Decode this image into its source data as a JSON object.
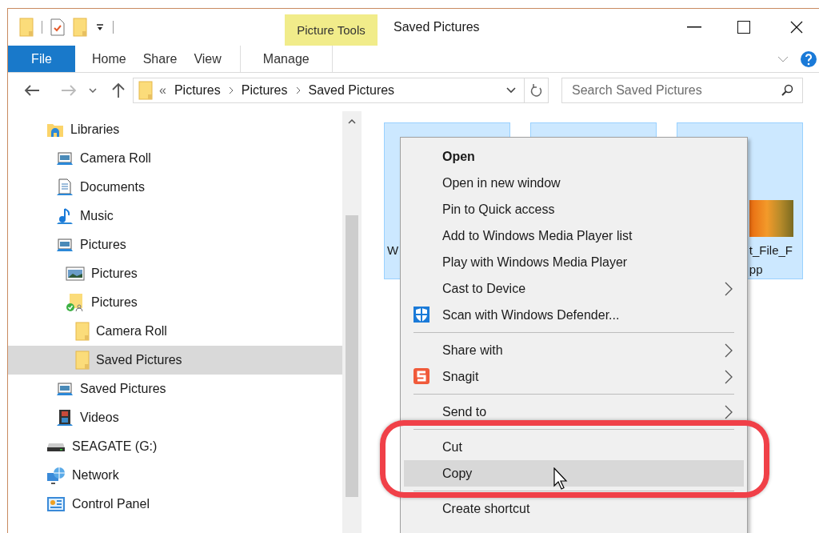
{
  "window": {
    "title": "Saved Pictures"
  },
  "ribbon": {
    "contextual_group": "Picture Tools",
    "tabs": [
      {
        "label": "File",
        "kind": "file"
      },
      {
        "label": "Home",
        "kind": "normal"
      },
      {
        "label": "Share",
        "kind": "normal"
      },
      {
        "label": "View",
        "kind": "normal"
      },
      {
        "label": "Manage",
        "kind": "contextual"
      }
    ]
  },
  "address_bar": {
    "overflow_mark": "«",
    "crumbs": [
      "Pictures",
      "Pictures",
      "Saved Pictures"
    ]
  },
  "search": {
    "placeholder": "Search Saved Pictures"
  },
  "sidebar": {
    "items": [
      {
        "label": "Libraries",
        "kind": "library",
        "selected": false,
        "children": [
          {
            "label": "Camera Roll",
            "kind": "library-item",
            "selected": false
          },
          {
            "label": "Documents",
            "kind": "documents",
            "selected": false
          },
          {
            "label": "Music",
            "kind": "music",
            "selected": false
          },
          {
            "label": "Pictures",
            "kind": "library-item",
            "selected": false,
            "children": [
              {
                "label": "Pictures",
                "kind": "picture",
                "selected": false
              },
              {
                "label": "Pictures",
                "kind": "synced-folder",
                "selected": false,
                "children": [
                  {
                    "label": "Camera Roll",
                    "kind": "folder",
                    "selected": false
                  },
                  {
                    "label": "Saved Pictures",
                    "kind": "folder",
                    "selected": true
                  }
                ]
              }
            ]
          },
          {
            "label": "Saved Pictures",
            "kind": "library-item",
            "selected": false
          },
          {
            "label": "Videos",
            "kind": "video",
            "selected": false
          }
        ]
      },
      {
        "label": "SEAGATE (G:)",
        "kind": "drive",
        "selected": false
      },
      {
        "label": "Network",
        "kind": "network",
        "selected": false
      },
      {
        "label": "Control Panel",
        "kind": "control-panel",
        "selected": false
      }
    ]
  },
  "files": [
    {
      "label_lines": [
        "W"
      ],
      "thumbnail": false,
      "selected": true
    },
    {
      "thumbnail": false,
      "selected": true
    },
    {
      "label_lines": [
        "t_File_F",
        "pp"
      ],
      "thumbnail": true,
      "selected": true
    }
  ],
  "context_menu": {
    "items": [
      {
        "kind": "item",
        "label": "Open",
        "bold": true,
        "submenu": false,
        "highlighted": false
      },
      {
        "kind": "item",
        "label": "Open in new window",
        "bold": false,
        "submenu": false,
        "highlighted": false
      },
      {
        "kind": "item",
        "label": "Pin to Quick access",
        "bold": false,
        "submenu": false,
        "highlighted": false
      },
      {
        "kind": "item",
        "label": "Add to Windows Media Player list",
        "bold": false,
        "submenu": false,
        "highlighted": false
      },
      {
        "kind": "item",
        "label": "Play with Windows Media Player",
        "bold": false,
        "submenu": false,
        "highlighted": false
      },
      {
        "kind": "item",
        "label": "Cast to Device",
        "bold": false,
        "submenu": true,
        "highlighted": false
      },
      {
        "kind": "scan-item",
        "label": "Scan with Windows Defender...",
        "bold": false,
        "submenu": false,
        "highlighted": false
      },
      {
        "kind": "separator"
      },
      {
        "kind": "item",
        "label": "Share with",
        "bold": false,
        "submenu": true,
        "highlighted": false
      },
      {
        "kind": "app-item",
        "label": "Snagit",
        "bold": false,
        "submenu": true,
        "highlighted": false
      },
      {
        "kind": "separator"
      },
      {
        "kind": "item",
        "label": "Send to",
        "bold": false,
        "submenu": true,
        "highlighted": false
      },
      {
        "kind": "separator"
      },
      {
        "kind": "item",
        "label": "Cut",
        "bold": false,
        "submenu": false,
        "highlighted": false
      },
      {
        "kind": "item",
        "label": "Copy",
        "bold": false,
        "submenu": false,
        "highlighted": true
      },
      {
        "kind": "separator"
      },
      {
        "kind": "item",
        "label": "Create shortcut",
        "bold": false,
        "submenu": false,
        "highlighted": false
      }
    ]
  }
}
